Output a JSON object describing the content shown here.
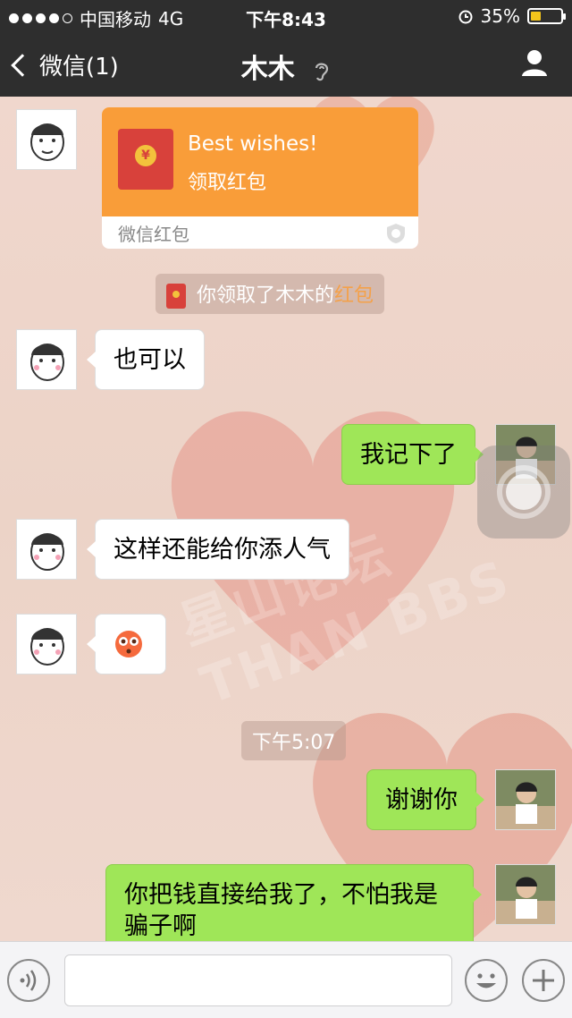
{
  "status_bar": {
    "carrier": "中国移动",
    "network": "4G",
    "time": "下午8:43",
    "battery": "35%",
    "battery_level": 0.35
  },
  "nav": {
    "back_label": "微信(1)",
    "title": "木木"
  },
  "messages": {
    "red_packet": {
      "title": "Best wishes!",
      "subtitle": "领取红包",
      "footer": "微信红包",
      "coin": "¥"
    },
    "system_red_packet": {
      "prefix": "你领取了木木的",
      "highlight": "红包"
    },
    "m1": "也可以",
    "m2": "我记下了",
    "m3": "这样还能给你添人气",
    "m4_emoji": "😳",
    "timestamp": "下午5:07",
    "m5": "谢谢你",
    "m6": "你把钱直接给我了，不怕我是骗子啊"
  },
  "watermark": "星山论坛 THAN BBS",
  "input": {
    "placeholder": ""
  },
  "colors": {
    "nav_bg": "#2e2e2e",
    "green_bubble": "#9fe658",
    "red_packet": "#f99d39",
    "highlight": "#f4a14a"
  }
}
